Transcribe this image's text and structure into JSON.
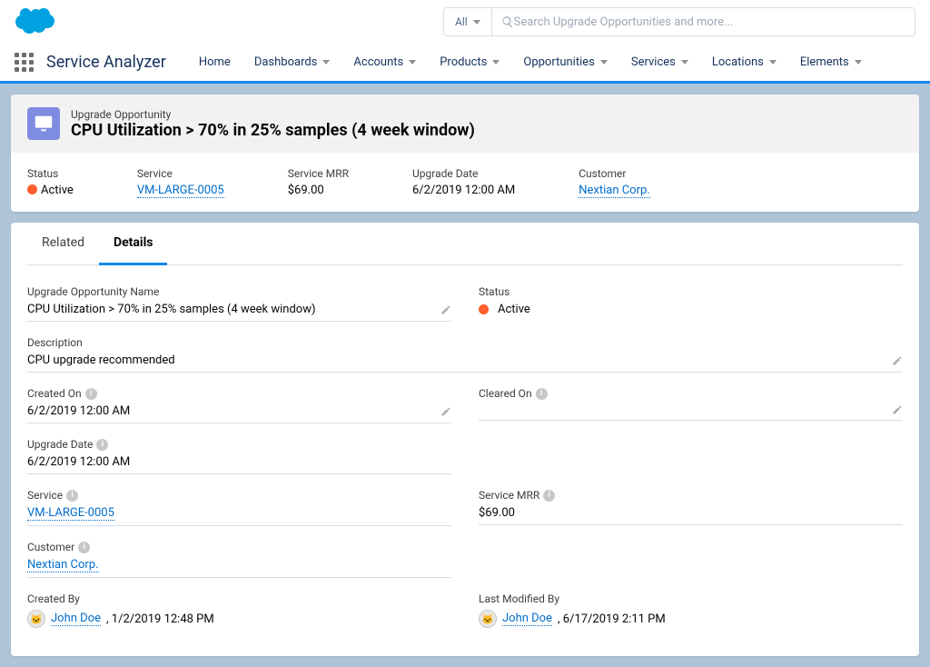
{
  "appTitle": "Service Analyzer",
  "search": {
    "filter": "All",
    "placeholder": "Search Upgrade Opportunities and more..."
  },
  "nav": [
    "Home",
    "Dashboards",
    "Accounts",
    "Products",
    "Opportunities",
    "Services",
    "Locations",
    "Elements"
  ],
  "record": {
    "objectLabel": "Upgrade Opportunity",
    "title": "CPU Utilization > 70% in 25% samples (4 week window)"
  },
  "summary": {
    "status": {
      "label": "Status",
      "value": "Active"
    },
    "service": {
      "label": "Service",
      "value": "VM-LARGE-0005"
    },
    "mrr": {
      "label": "Service MRR",
      "value": "$69.00"
    },
    "upgradeDate": {
      "label": "Upgrade Date",
      "value": "6/2/2019 12:00 AM"
    },
    "customer": {
      "label": "Customer",
      "value": "Nextian Corp."
    }
  },
  "tabs": {
    "related": "Related",
    "details": "Details"
  },
  "details": {
    "name": {
      "label": "Upgrade Opportunity Name",
      "value": "CPU Utilization > 70% in 25% samples (4 week window)"
    },
    "status": {
      "label": "Status",
      "value": "Active"
    },
    "description": {
      "label": "Description",
      "value": "CPU upgrade recommended"
    },
    "createdOn": {
      "label": "Created On",
      "value": "6/2/2019 12:00 AM"
    },
    "clearedOn": {
      "label": "Cleared On",
      "value": ""
    },
    "upgradeDate": {
      "label": "Upgrade Date",
      "value": "6/2/2019 12:00 AM"
    },
    "service": {
      "label": "Service",
      "value": "VM-LARGE-0005"
    },
    "mrr": {
      "label": "Service MRR",
      "value": "$69.00"
    },
    "customer": {
      "label": "Customer",
      "value": "Nextian Corp."
    },
    "createdBy": {
      "label": "Created By",
      "user": "John Doe",
      "date": ", 1/2/2019 12:48 PM"
    },
    "modifiedBy": {
      "label": "Last Modified By",
      "user": "John Doe",
      "date": ", 6/17/2019 2:11 PM"
    }
  }
}
